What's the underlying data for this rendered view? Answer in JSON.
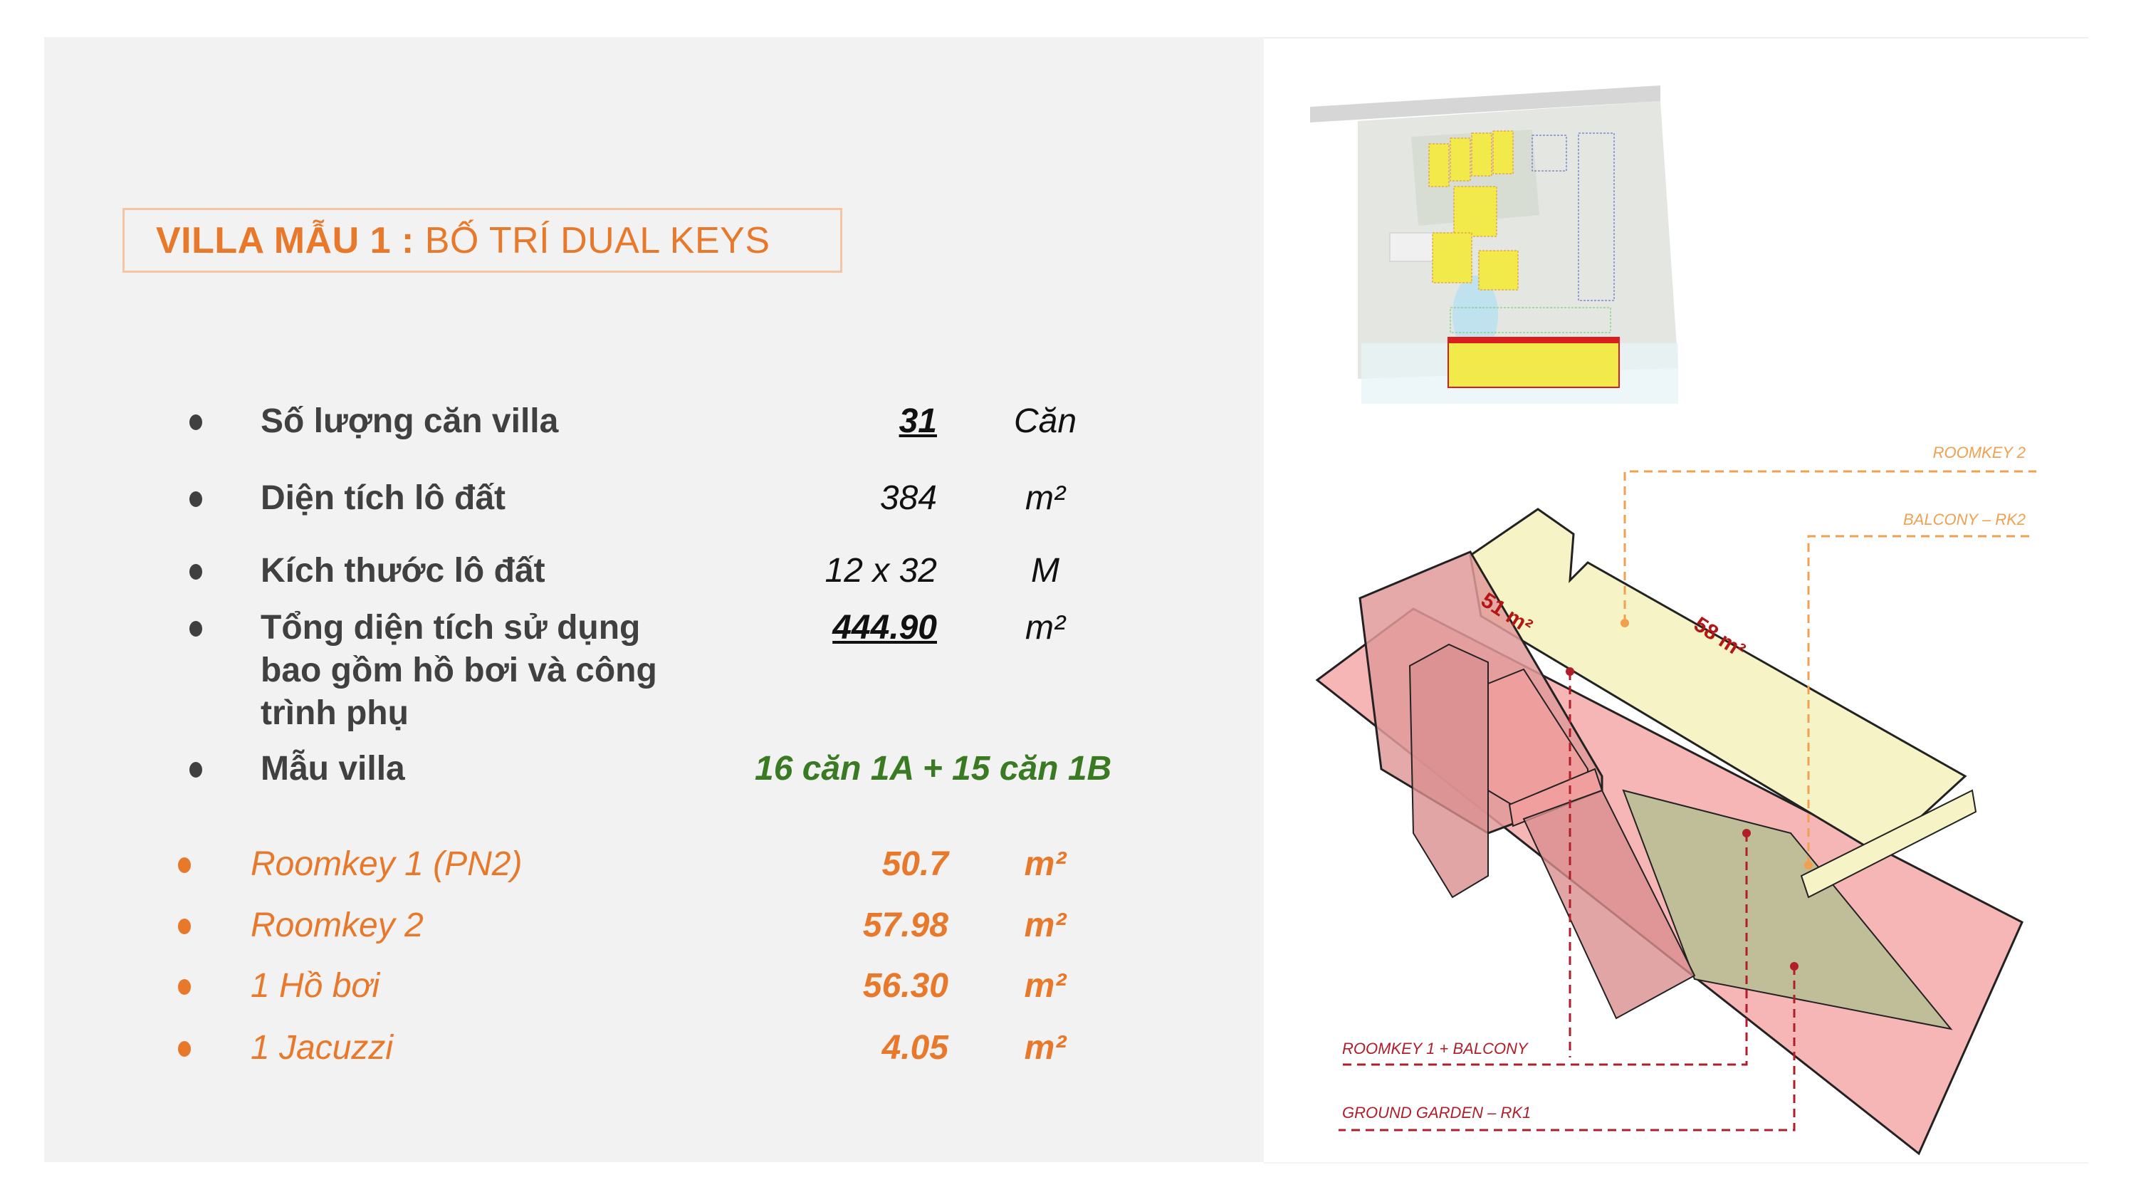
{
  "title": {
    "bold_part": "VILLA MẪU 1 :",
    "light_part": " BỐ TRÍ DUAL KEYS"
  },
  "specs": [
    {
      "label": "Số lượng căn villa",
      "value": "31",
      "unit": "Căn"
    },
    {
      "label": "Diện tích lô đất",
      "value": "384",
      "unit": "m²"
    },
    {
      "label": "Kích thước lô đất",
      "value": "12 x 32",
      "unit": "M"
    },
    {
      "label_lines": [
        "Tổng diện tích sử dụng",
        "bao gồm hồ bơi và công",
        "trình phụ"
      ],
      "value": "444.90",
      "unit": "m²"
    },
    {
      "label": "Mẫu villa",
      "value": "16 căn 1A + 15 căn 1B"
    }
  ],
  "areas": [
    {
      "label": "Roomkey 1 (PN2)",
      "value": "50.7",
      "unit": "m²"
    },
    {
      "label": "Roomkey 2",
      "value": "57.98",
      "unit": "m²"
    },
    {
      "label": "1 Hồ bơi",
      "value": "56.30",
      "unit": "m²"
    },
    {
      "label": "1 Jacuzzi",
      "value": "4.05",
      "unit": "m²"
    }
  ],
  "diagram": {
    "area_label_rk1": "51 m²",
    "area_label_rk2": "58 m²",
    "callouts": {
      "roomkey2": "ROOMKEY 2",
      "balcony_rk2": "BALCONY – RK2",
      "roomkey1_balcony": "ROOMKEY 1 + BALCONY",
      "ground_garden": "GROUND GARDEN – RK1"
    }
  },
  "colors": {
    "accent_orange": "#e8782a",
    "title_border": "#f5c4a3",
    "green": "#3a7a22",
    "text_dark": "#404040",
    "rk1_pink": "#f4a6a6",
    "rk2_yellow": "#f6f4c6",
    "callout_red": "#b01e2a",
    "callout_orange": "#f0a050"
  }
}
